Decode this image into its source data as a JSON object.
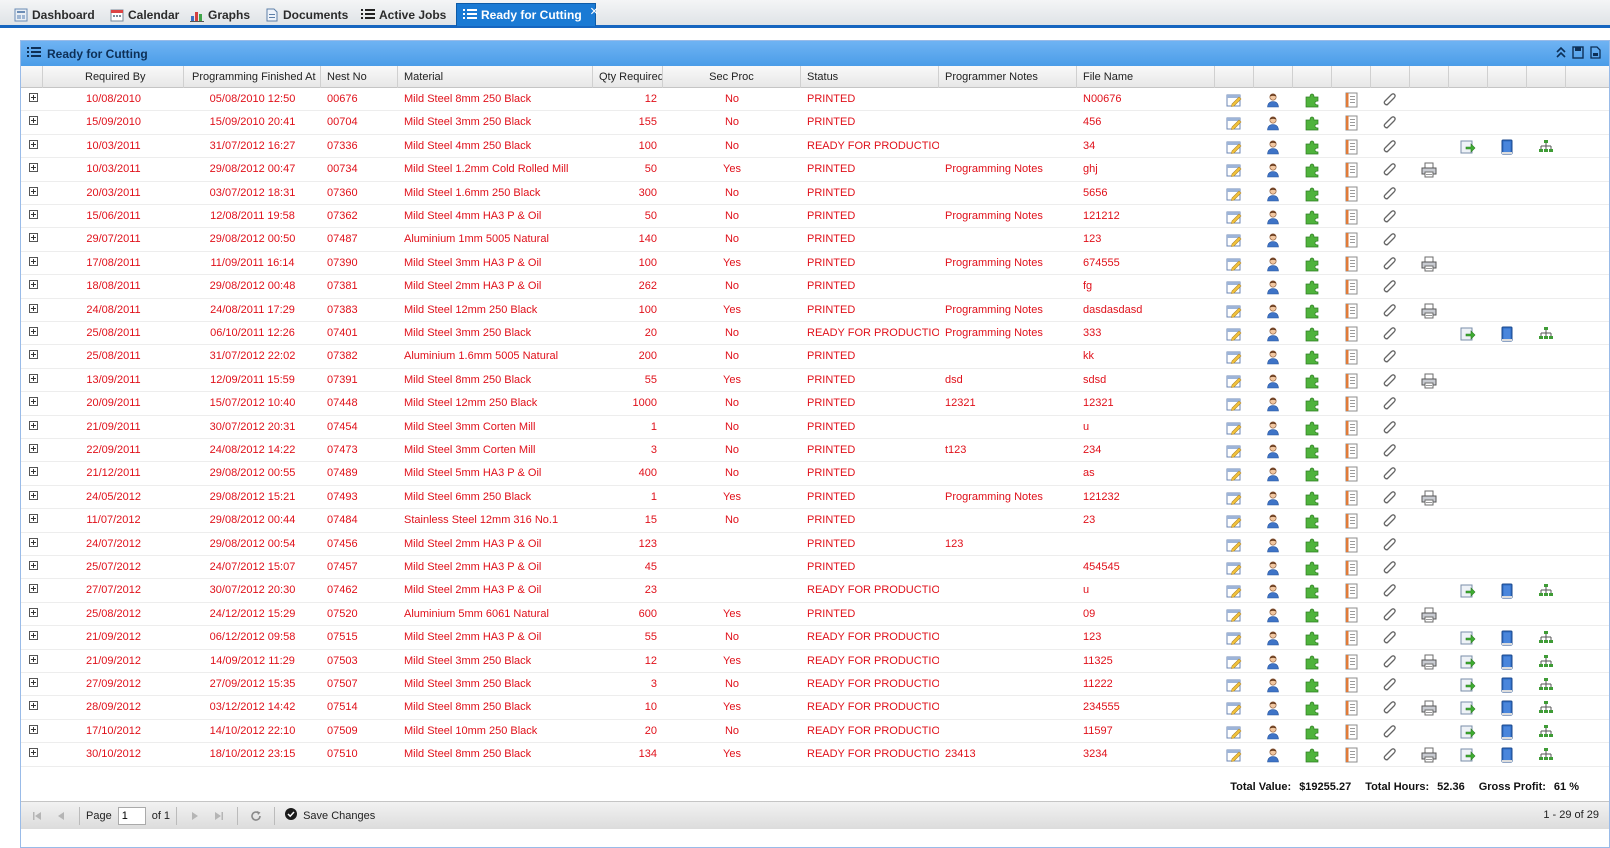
{
  "tabs": [
    {
      "label": "Dashboard",
      "icon": "dashboard-icon"
    },
    {
      "label": "Calendar",
      "icon": "calendar-icon"
    },
    {
      "label": "Graphs",
      "icon": "graphs-icon"
    },
    {
      "label": "Documents",
      "icon": "documents-icon"
    },
    {
      "label": "Active Jobs",
      "icon": "list-icon"
    },
    {
      "label": "Ready for Cutting",
      "icon": "list-icon",
      "active": true
    }
  ],
  "panel": {
    "title": "Ready for Cutting"
  },
  "columns": {
    "required_by": "Required By",
    "prog_finished": "Programming Finished At",
    "nest_no": "Nest No",
    "material": "Material",
    "qty": "Qty Required",
    "sec_proc": "Sec Proc",
    "status": "Status",
    "notes": "Programmer Notes",
    "file": "File Name"
  },
  "rows": [
    [
      "10/08/2010",
      "05/08/2010 12:50",
      "00676",
      "Mild Steel 8mm 250 Black",
      "12",
      "No",
      "PRINTED",
      "",
      "N00676",
      0
    ],
    [
      "15/09/2010",
      "15/09/2010 20:41",
      "00704",
      "Mild Steel 3mm 250 Black",
      "155",
      "No",
      "PRINTED",
      "",
      "456",
      0
    ],
    [
      "10/03/2011",
      "31/07/2012 16:27",
      "07336",
      "Mild Steel 4mm 250 Black",
      "100",
      "No",
      "READY FOR PRODUCTION",
      "",
      "34",
      2
    ],
    [
      "10/03/2011",
      "29/08/2012 00:47",
      "00734",
      "Mild Steel 1.2mm Cold Rolled Mill",
      "50",
      "Yes",
      "PRINTED",
      "Programming Notes",
      "ghj",
      1
    ],
    [
      "20/03/2011",
      "03/07/2012 18:31",
      "07360",
      "Mild Steel 1.6mm 250 Black",
      "300",
      "No",
      "PRINTED",
      "",
      "5656",
      0
    ],
    [
      "15/06/2011",
      "12/08/2011 19:58",
      "07362",
      "Mild Steel 4mm HA3 P & Oil",
      "50",
      "No",
      "PRINTED",
      "Programming Notes",
      "121212",
      0
    ],
    [
      "29/07/2011",
      "29/08/2012 00:50",
      "07487",
      "Aluminium 1mm 5005 Natural",
      "140",
      "No",
      "PRINTED",
      "",
      "123",
      0
    ],
    [
      "17/08/2011",
      "11/09/2011 16:14",
      "07390",
      "Mild Steel 3mm HA3 P & Oil",
      "100",
      "Yes",
      "PRINTED",
      "Programming Notes",
      "674555",
      1
    ],
    [
      "18/08/2011",
      "29/08/2012 00:48",
      "07381",
      "Mild Steel 2mm HA3 P & Oil",
      "262",
      "No",
      "PRINTED",
      "",
      "fg",
      0
    ],
    [
      "24/08/2011",
      "24/08/2011 17:29",
      "07383",
      "Mild Steel 12mm 250 Black",
      "100",
      "Yes",
      "PRINTED",
      "Programming Notes",
      "dasdasdasd",
      1
    ],
    [
      "25/08/2011",
      "06/10/2011 12:26",
      "07401",
      "Mild Steel 3mm 250 Black",
      "20",
      "No",
      "READY FOR PRODUCTION",
      "Programming Notes",
      "333",
      2
    ],
    [
      "25/08/2011",
      "31/07/2012 22:02",
      "07382",
      "Aluminium 1.6mm 5005 Natural",
      "200",
      "No",
      "PRINTED",
      "",
      "kk",
      0
    ],
    [
      "13/09/2011",
      "12/09/2011 15:59",
      "07391",
      "Mild Steel 8mm 250 Black",
      "55",
      "Yes",
      "PRINTED",
      "dsd",
      "sdsd",
      1
    ],
    [
      "20/09/2011",
      "15/07/2012 10:40",
      "07448",
      "Mild Steel 12mm 250 Black",
      "1000",
      "No",
      "PRINTED",
      "12321",
      "12321",
      0
    ],
    [
      "21/09/2011",
      "30/07/2012 20:31",
      "07454",
      "Mild Steel 3mm Corten Mill",
      "1",
      "No",
      "PRINTED",
      "",
      "u",
      0
    ],
    [
      "22/09/2011",
      "24/08/2012 14:22",
      "07473",
      "Mild Steel 3mm Corten Mill",
      "3",
      "No",
      "PRINTED",
      "t123",
      "234",
      0
    ],
    [
      "21/12/2011",
      "29/08/2012 00:55",
      "07489",
      "Mild Steel 5mm HA3 P & Oil",
      "400",
      "No",
      "PRINTED",
      "",
      "as",
      0
    ],
    [
      "24/05/2012",
      "29/08/2012 15:21",
      "07493",
      "Mild Steel 6mm 250 Black",
      "1",
      "Yes",
      "PRINTED",
      "Programming Notes",
      "121232",
      1
    ],
    [
      "11/07/2012",
      "29/08/2012 00:44",
      "07484",
      "Stainless Steel 12mm 316 No.1",
      "15",
      "No",
      "PRINTED",
      "",
      "23",
      0
    ],
    [
      "24/07/2012",
      "29/08/2012 00:54",
      "07456",
      "Mild Steel 2mm HA3 P & Oil",
      "123",
      "",
      "PRINTED",
      "123",
      "",
      0
    ],
    [
      "25/07/2012",
      "24/07/2012 15:07",
      "07457",
      "Mild Steel 2mm HA3 P & Oil",
      "45",
      "",
      "PRINTED",
      "",
      "454545",
      0
    ],
    [
      "27/07/2012",
      "30/07/2012 20:30",
      "07462",
      "Mild Steel 2mm HA3 P & Oil",
      "23",
      "",
      "READY FOR PRODUCTION",
      "",
      "u",
      2
    ],
    [
      "25/08/2012",
      "24/12/2012 15:29",
      "07520",
      "Aluminium 5mm 6061 Natural",
      "600",
      "Yes",
      "PRINTED",
      "",
      "09",
      1
    ],
    [
      "21/09/2012",
      "06/12/2012 09:58",
      "07515",
      "Mild Steel 2mm HA3 P & Oil",
      "55",
      "No",
      "READY FOR PRODUCTION",
      "",
      "123",
      2
    ],
    [
      "21/09/2012",
      "14/09/2012 11:29",
      "07503",
      "Mild Steel 3mm 250 Black",
      "12",
      "Yes",
      "READY FOR PRODUCTION",
      "",
      "11325",
      3
    ],
    [
      "27/09/2012",
      "27/09/2012 15:35",
      "07507",
      "Mild Steel 3mm 250 Black",
      "3",
      "No",
      "READY FOR PRODUCTION",
      "",
      "11222",
      2
    ],
    [
      "28/09/2012",
      "03/12/2012 14:42",
      "07514",
      "Mild Steel 8mm 250 Black",
      "10",
      "Yes",
      "READY FOR PRODUCTION",
      "",
      "234555",
      3
    ],
    [
      "17/10/2012",
      "14/10/2012 22:10",
      "07509",
      "Mild Steel 10mm 250 Black",
      "20",
      "No",
      "READY FOR PRODUCTION",
      "",
      "11597",
      2
    ],
    [
      "30/10/2012",
      "18/10/2012 23:15",
      "07510",
      "Mild Steel 8mm 250 Black",
      "134",
      "Yes",
      "READY FOR PRODUCTION",
      "23413",
      "3234",
      3
    ]
  ],
  "totals": {
    "value_label": "Total Value:",
    "value": "$19255.27",
    "hours_label": "Total Hours:",
    "hours": "52.36",
    "profit_label": "Gross Profit:",
    "profit": "61 %"
  },
  "pager": {
    "page_label": "Page",
    "page_value": "1",
    "of_label": "of 1",
    "save_label": "Save Changes",
    "range": "1 - 29 of 29"
  },
  "colors": {
    "row_text": "#e0101a",
    "accent": "#1a7ad4"
  }
}
